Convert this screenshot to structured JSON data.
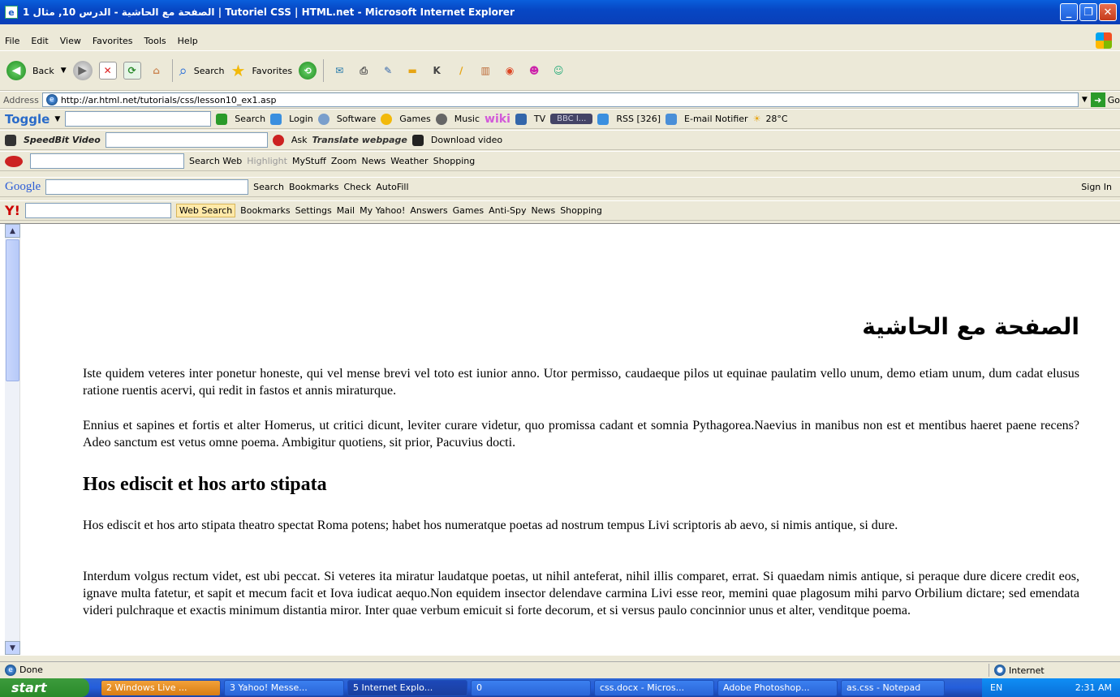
{
  "window": {
    "title": "الصفحة مع الحاشية - الدرس 10, مثال 1 | Tutoriel CSS | HTML.net - Microsoft Internet Explorer"
  },
  "menu": [
    "File",
    "Edit",
    "View",
    "Favorites",
    "Tools",
    "Help"
  ],
  "std_toolbar": {
    "back": "Back",
    "search": "Search",
    "favorites": "Favorites"
  },
  "address": {
    "label": "Address",
    "url": "http://ar.html.net/tutorials/css/lesson10_ex1.asp",
    "go": "Go"
  },
  "toolbars": {
    "toggle": {
      "brand": "Toggle",
      "search": "Search",
      "login": "Login",
      "software": "Software",
      "games": "Games",
      "music": "Music",
      "wiki": "wiki",
      "tv": "TV",
      "radio": "BBC I...",
      "rss": "RSS [326]",
      "email": "E-mail Notifier",
      "weather": "28°C"
    },
    "speedbit": {
      "brand": "SpeedBit Video",
      "ask": "Ask",
      "translate": "Translate webpage",
      "download": "Download video"
    },
    "ask": {
      "search_web": "Search Web",
      "highlight": "Highlight",
      "mystuff": "MyStuff",
      "zoom": "Zoom",
      "news": "News",
      "weather": "Weather",
      "shopping": "Shopping"
    },
    "google": {
      "brand": "Google",
      "search": "Search",
      "bookmarks": "Bookmarks",
      "check": "Check",
      "autofill": "AutoFill",
      "sign_in": "Sign In"
    },
    "yahoo": {
      "web_search": "Web Search",
      "bookmarks": "Bookmarks",
      "settings": "Settings",
      "mail": "Mail",
      "my_yahoo": "My Yahoo!",
      "answers": "Answers",
      "games": "Games",
      "antispy": "Anti-Spy",
      "news": "News",
      "shopping": "Shopping"
    }
  },
  "page": {
    "arabic_heading": "الصفحة مع الحاشية",
    "p1": "Iste quidem veteres inter ponetur honeste, qui vel mense brevi vel toto est iunior anno. Utor permisso, caudaeque pilos ut equinae paulatim vello unum, demo etiam unum, dum cadat elusus ratione ruentis acervi, qui redit in fastos et annis miraturque.",
    "p2": "Ennius et sapines et fortis et alter Homerus, ut critici dicunt, leviter curare videtur, quo promissa cadant et somnia Pythagorea.Naevius in manibus non est et mentibus haeret paene recens? Adeo sanctum est vetus omne poema. Ambigitur quotiens, sit prior, Pacuvius docti.",
    "h2": "Hos ediscit et hos arto stipata",
    "p3": "Hos ediscit et hos arto stipata theatro spectat Roma potens; habet hos numeratque poetas ad nostrum tempus Livi scriptoris ab aevo, si nimis antique, si dure.",
    "p4": "Interdum volgus rectum videt, est ubi peccat. Si veteres ita miratur laudatque poetas, ut nihil anteferat, nihil illis comparet, errat. Si quaedam nimis antique, si peraque dure dicere credit eos, ignave multa fatetur, et sapit et mecum facit et Iova iudicat aequo.Non equidem insector delendave carmina Livi esse reor, memini quae plagosum mihi parvo Orbilium dictare; sed emendata videri pulchraque et exactis minimum distantia miror. Inter quae verbum emicuit si forte decorum, et si versus paulo concinnior unus et alter, venditque poema."
  },
  "status": {
    "left": "Done",
    "zone": "Internet"
  },
  "taskbar": {
    "start": "start",
    "tasks": [
      "2 Windows Live ...",
      "3 Yahoo! Messe...",
      "5 Internet Explo...",
      "0",
      "css.docx - Micros...",
      "Adobe Photoshop...",
      "as.css - Notepad"
    ],
    "lang": "EN",
    "time": "2:31 AM"
  }
}
